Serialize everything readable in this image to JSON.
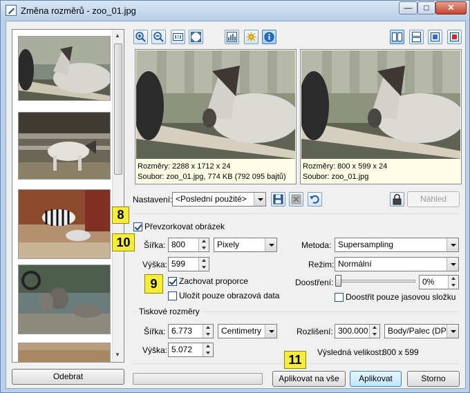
{
  "window": {
    "title": "Změna rozměrů - zoo_01.jpg"
  },
  "thumbnails": [
    "horse-thumb",
    "pony-thumb",
    "zebra-thumb",
    "elephants-thumb",
    "tiger-thumb"
  ],
  "left_panel": {
    "remove_label": "Odebrat"
  },
  "preview": {
    "original": {
      "dims": "Rozměry: 2288 x 1712 x 24",
      "file": "Soubor: zoo_01.jpg, 774 KB (792 095 bajtů)"
    },
    "result": {
      "dims": "Rozměry: 800 x 599 x 24",
      "file": "Soubor: zoo_01.jpg"
    }
  },
  "preset": {
    "label": "Nastavení:",
    "value": "<Poslední použité>",
    "preview_label": "Náhled"
  },
  "resample": {
    "label": "Převzorkovat obrázek",
    "checked": true,
    "width_label": "Šířka:",
    "width": "800",
    "height_label": "Výška:",
    "height": "599",
    "unit": "Pixely",
    "keep_proportions_label": "Zachovat proporce",
    "keep_proportions": true,
    "save_image_data_label": "Uložit pouze obrazová data",
    "save_image_data": false,
    "method_label": "Metoda:",
    "method": "Supersampling",
    "mode_label": "Režim:",
    "mode": "Normální",
    "sharpen_label": "Doostření:",
    "sharpen_value": "0%",
    "sharpen_level": 0,
    "sharpen_luma_label": "Doostřit pouze jasovou složku",
    "sharpen_luma": false
  },
  "print": {
    "section_label": "Tiskové rozměry",
    "width_label": "Šířka:",
    "width": "6.773",
    "height_label": "Výška:",
    "height": "5.072",
    "unit": "Centimetry",
    "resolution_label": "Rozlišení:",
    "resolution": "300.000",
    "resolution_unit": "Body/Palec (DPI)",
    "result_size_label": "Výsledná velikost:",
    "result_size": "800 x 599"
  },
  "buttons": {
    "apply_all": "Aplikovat na vše",
    "apply": "Aplikovat",
    "cancel": "Storno"
  },
  "badges": [
    "8",
    "10",
    "9",
    "11"
  ]
}
